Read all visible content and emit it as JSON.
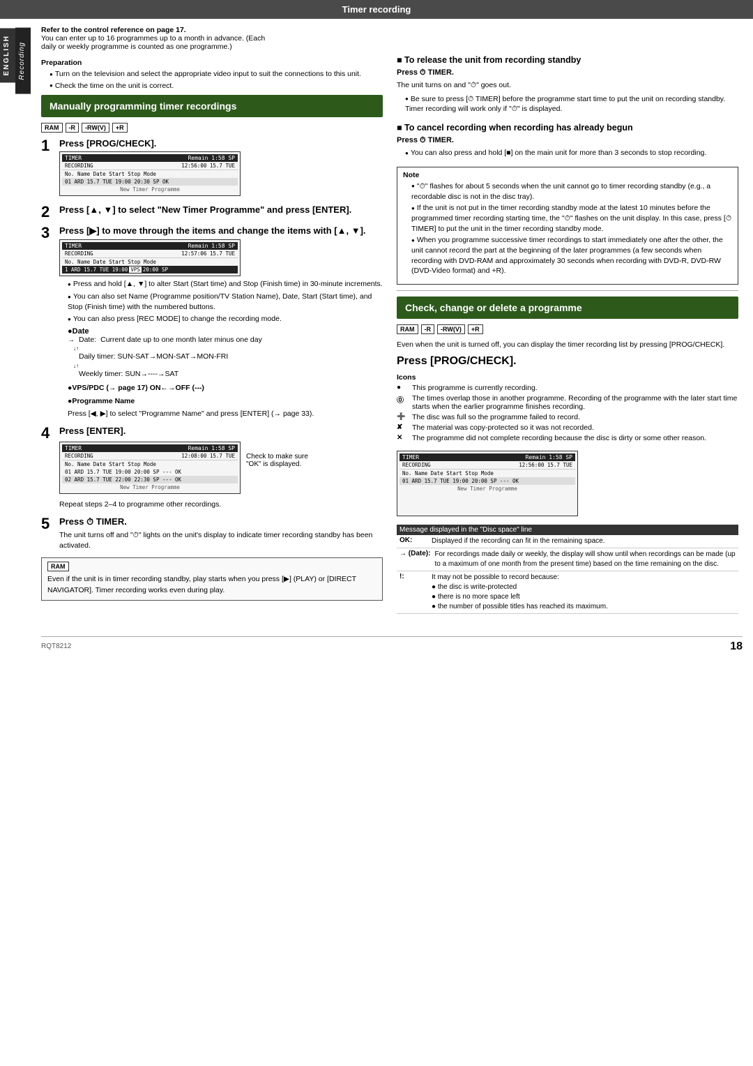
{
  "header": {
    "title": "Timer recording"
  },
  "side_labels": {
    "english": "ENGLISH",
    "recording": "Recording"
  },
  "left_col": {
    "reference": {
      "bold": "Refer to the control reference on page 17.",
      "text1": "You can enter up to 16 programmes up to a month in advance. (Each",
      "text2": "daily or weekly programme is counted as one programme.)"
    },
    "preparation": {
      "title": "Preparation",
      "bullets": [
        "Turn on the television and select the appropriate video input to suit the connections to this unit.",
        "Check the time on the unit is correct."
      ]
    },
    "section_heading": "Manually programming timer recordings",
    "badges": [
      "RAM",
      "-R",
      "-RW(V)",
      "+R"
    ],
    "step1": {
      "number": "1",
      "title": "Press [PROG/CHECK].",
      "screen1": {
        "header_left": "TIMER",
        "header_right": "Remain  1:58 SP",
        "header2_left": "RECORDING",
        "header2_right": "12:56:00  15.7  TUE",
        "cols": "No.  Name  Date  Start  Stop  Mode",
        "row1": "01  ARD  15.7 TUE  19:00  20:30  SP  OK",
        "footer": "New Timer Programme"
      }
    },
    "step2": {
      "number": "2",
      "title": "Press [▲, ▼] to select \"New Timer Programme\" and press [ENTER]."
    },
    "step3": {
      "number": "3",
      "title": "Press [▶] to move through the items and change the items with [▲, ▼].",
      "screen2": {
        "header_left": "TIMER",
        "header_right": "Remain  1:58 SP",
        "header2_left": "RECORDING",
        "header2_right": "12:57:06  15.7  TUE",
        "cols": "No.  Name  Date  Start  Stop  Mode",
        "row1": "1  ARD  15.7 TUE  19:00",
        "highlight_col": "VPS",
        "highlight_val": "20:00  SP"
      },
      "bullets": [
        "Press and hold [▲, ▼] to alter Start (Start time) and Stop (Finish time) in 30-minute increments.",
        "You can also set Name (Programme position/TV Station Name), Date, Start (Start time), and Stop (Finish time) with the numbered buttons.",
        "You can also press [REC MODE] to change the recording mode."
      ],
      "date_section": {
        "title": "●Date",
        "date_label": "Date:",
        "date_text": "Current date up to one month later minus one day",
        "daily_timer": "Daily timer:  SUN-SAT→MON-SAT→MON-FRI",
        "weekly_timer": "Weekly timer: SUN→----→SAT"
      },
      "vps_pdc": "●VPS/PDC (→ page 17) ON←→OFF (---)",
      "prog_name": {
        "title": "●Programme Name",
        "text": "Press [◀, ▶] to select \"Programme Name\" and press [ENTER] (→ page 33)."
      }
    },
    "step4": {
      "number": "4",
      "title": "Press [ENTER].",
      "screen3": {
        "header_left": "TIMER",
        "header_right": "Remain  1:58 SP",
        "header2_left": "RECORDING",
        "header2_right": "12:08:00  15.7  TUE",
        "cols": "No.  Name  Date  Start  Stop  Mode",
        "row1": "01  ARD  15.7 TUE  19:00  20:00  SP  ---  OK",
        "row2": "02  ARD  15.7 TUE  22:00  22:30  SP  ---  OK",
        "footer": "New Timer Programme",
        "check_label": "Check to make sure \"OK\" is displayed."
      },
      "repeat_text": "Repeat steps 2–4 to programme other recordings."
    },
    "step5": {
      "number": "5",
      "title": "Press ⏱ TIMER.",
      "text": "The unit turns off and \"⏱\" lights on the unit's display to indicate timer recording standby has been activated."
    },
    "ram_note": {
      "label": "RAM",
      "text": "Even if the unit is in timer recording standby, play starts when you press [▶] (PLAY) or [DIRECT NAVIGATOR]. Timer recording works even during play."
    }
  },
  "right_col": {
    "release_section": {
      "heading": "■ To release the unit from recording standby",
      "press": "Press ⏱ TIMER.",
      "text1": "The unit turns on and \"⏱\" goes out.",
      "bullets": [
        "Be sure to press [⏱ TIMER] before the programme start time to put the unit on recording standby. Timer recording will work only if \"⏱\" is displayed."
      ]
    },
    "cancel_section": {
      "heading": "■ To cancel recording when recording has already begun",
      "press": "Press ⏱ TIMER.",
      "bullets": [
        "You can also press and hold [■] on the main unit for more than 3 seconds to stop recording."
      ]
    },
    "note_box": {
      "title": "Note",
      "bullets": [
        "\"⏱\" flashes for about 5 seconds when the unit cannot go to timer recording standby (e.g., a recordable disc is not in the disc tray).",
        "If the unit is not put in the timer recording standby mode at the latest 10 minutes before the programmed timer recording starting time, the \"⏱\" flashes on the unit display. In this case, press [⏱ TIMER] to put the unit in the timer recording standby mode.",
        "When you programme successive timer recordings to start immediately one after the other, the unit cannot record the part at the beginning of the later programmes (a few seconds when recording with DVD-RAM and approximately 30 seconds when recording with DVD-R, DVD-RW (DVD-Video format) and +R)."
      ]
    },
    "check_section": {
      "heading": "Check, change or delete a programme",
      "badges": [
        "RAM",
        "-R",
        "-RW(V)",
        "+R"
      ],
      "text": "Even when the unit is turned off, you can display the timer recording list by pressing [PROG/CHECK].",
      "press_heading": "Press [PROG/CHECK].",
      "icons_heading": "Icons",
      "icons": [
        {
          "symbol": "●",
          "text": "This programme is currently recording."
        },
        {
          "symbol": "⓪",
          "text": "The times overlap those in another programme. Recording of the programme with the later start time starts when the earlier programme finishes recording."
        },
        {
          "symbol": "➕",
          "text": "The disc was full so the programme failed to record."
        },
        {
          "symbol": "✘",
          "text": "The material was copy-protected so it was not recorded."
        },
        {
          "symbol": "✕",
          "text": "The programme did not complete recording because the disc is dirty or some other reason."
        }
      ],
      "screen4": {
        "header_left": "TIMER",
        "header_right": "Remain  1:58 SP",
        "header2_left": "RECORDING",
        "header2_right": "12:56:00  15.7  TUE",
        "cols": "No.  Name  Date  Start  Stop  Mode",
        "row1": "01  ARD  15.7 TUE  19:00  20:00  SP  ---  OK",
        "footer": "New Timer Programme"
      },
      "message_table": {
        "title": "Message displayed in the \"Disc space\" line",
        "rows": [
          {
            "key": "OK:",
            "value": "Displayed if the recording can fit in the remaining space."
          },
          {
            "key": "→ (Date):",
            "value": "For recordings made daily or weekly, the display will show until when recordings can be made (up to a maximum of one month from the present time) based on the time remaining on the disc."
          },
          {
            "key": "!:",
            "value": "It may not be possible to record because:\n● the disc is write-protected\n● there is no more space left\n● the number of possible titles has reached its maximum."
          }
        ]
      }
    }
  },
  "footer": {
    "page_number": "18",
    "model_number": "RQT8212"
  }
}
